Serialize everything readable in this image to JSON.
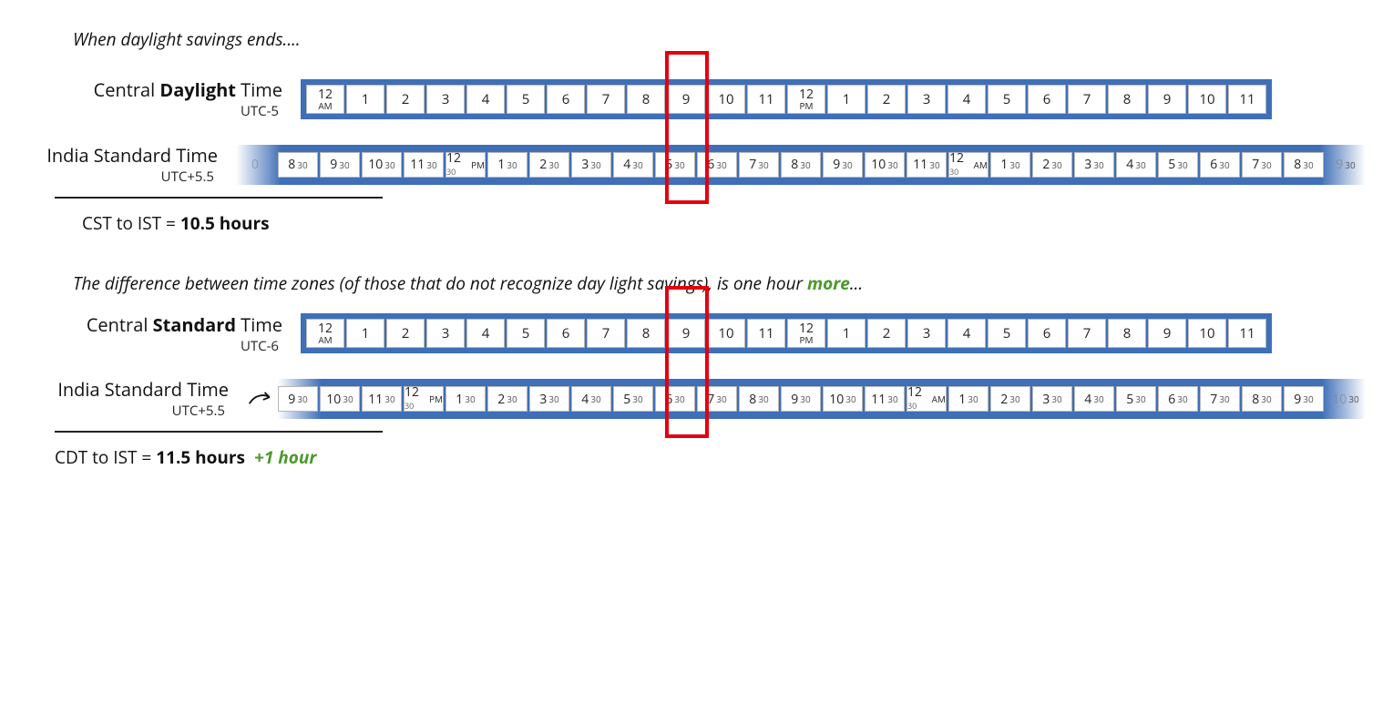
{
  "intro1": "When daylight savings ends....",
  "intro2_a": "The difference between time zones (of those that do not recognize day light savings), is one hour ",
  "intro2_more": "more",
  "intro2_b": "...",
  "labels": {
    "cdt_l1a": "Central ",
    "cdt_l1b": "Daylight",
    "cdt_l1c": " Time",
    "cdt_l2": "UTC-5",
    "ist_l1": "India Standard Time",
    "ist_l2": "UTC+5.5",
    "cst_l1a": "Central ",
    "cst_l1b": "Standard",
    "cst_l1c": " Time",
    "cst_l2": "UTC-6"
  },
  "result1_a": "CST to IST = ",
  "result1_b": "10.5 hours",
  "result2_a": "CDT to IST = ",
  "result2_b": "11.5 hours",
  "result2_plus": "+1 hour",
  "central_hours": [
    {
      "t": "12",
      "s": "AM"
    },
    {
      "t": "1"
    },
    {
      "t": "2"
    },
    {
      "t": "3"
    },
    {
      "t": "4"
    },
    {
      "t": "5"
    },
    {
      "t": "6"
    },
    {
      "t": "7"
    },
    {
      "t": "8"
    },
    {
      "t": "9"
    },
    {
      "t": "10"
    },
    {
      "t": "11"
    },
    {
      "t": "12",
      "s": "PM"
    },
    {
      "t": "1"
    },
    {
      "t": "2"
    },
    {
      "t": "3"
    },
    {
      "t": "4"
    },
    {
      "t": "5"
    },
    {
      "t": "6"
    },
    {
      "t": "7"
    },
    {
      "t": "8"
    },
    {
      "t": "9"
    },
    {
      "t": "10"
    },
    {
      "t": "11"
    }
  ],
  "ist_a": [
    {
      "t": "0",
      "g": true,
      "m": ""
    },
    {
      "t": "8",
      "m": "30"
    },
    {
      "t": "9",
      "m": "30"
    },
    {
      "t": "10",
      "m": "30"
    },
    {
      "t": "11",
      "m": "30"
    },
    {
      "t": "12",
      "m": "30",
      "s": "PM"
    },
    {
      "t": "1",
      "m": "30"
    },
    {
      "t": "2",
      "m": "30"
    },
    {
      "t": "3",
      "m": "30"
    },
    {
      "t": "4",
      "m": "30"
    },
    {
      "t": "5",
      "m": "30"
    },
    {
      "t": "6",
      "m": "30"
    },
    {
      "t": "7",
      "m": "30"
    },
    {
      "t": "8",
      "m": "30"
    },
    {
      "t": "9",
      "m": "30"
    },
    {
      "t": "10",
      "m": "30"
    },
    {
      "t": "11",
      "m": "30"
    },
    {
      "t": "12",
      "m": "30",
      "s": "AM"
    },
    {
      "t": "1",
      "m": "30"
    },
    {
      "t": "2",
      "m": "30"
    },
    {
      "t": "3",
      "m": "30"
    },
    {
      "t": "4",
      "m": "30"
    },
    {
      "t": "5",
      "m": "30"
    },
    {
      "t": "6",
      "m": "30"
    },
    {
      "t": "7",
      "m": "30"
    },
    {
      "t": "8",
      "m": "30"
    },
    {
      "t": "9",
      "m": "30",
      "gR": true
    }
  ],
  "ist_b": [
    {
      "t": "9",
      "m": "30"
    },
    {
      "t": "10",
      "m": "30"
    },
    {
      "t": "11",
      "m": "30"
    },
    {
      "t": "12",
      "m": "30",
      "s": "PM"
    },
    {
      "t": "1",
      "m": "30"
    },
    {
      "t": "2",
      "m": "30"
    },
    {
      "t": "3",
      "m": "30"
    },
    {
      "t": "4",
      "m": "30"
    },
    {
      "t": "5",
      "m": "30"
    },
    {
      "t": "6",
      "m": "30"
    },
    {
      "t": "7",
      "m": "30"
    },
    {
      "t": "8",
      "m": "30"
    },
    {
      "t": "9",
      "m": "30"
    },
    {
      "t": "10",
      "m": "30"
    },
    {
      "t": "11",
      "m": "30"
    },
    {
      "t": "12",
      "m": "30",
      "s": "AM"
    },
    {
      "t": "1",
      "m": "30"
    },
    {
      "t": "2",
      "m": "30"
    },
    {
      "t": "3",
      "m": "30"
    },
    {
      "t": "4",
      "m": "30"
    },
    {
      "t": "5",
      "m": "30"
    },
    {
      "t": "6",
      "m": "30"
    },
    {
      "t": "7",
      "m": "30"
    },
    {
      "t": "8",
      "m": "30"
    },
    {
      "t": "9",
      "m": "30"
    },
    {
      "t": "10",
      "m": "30",
      "gR": true
    }
  ],
  "highlight": {
    "central_index": 9
  }
}
